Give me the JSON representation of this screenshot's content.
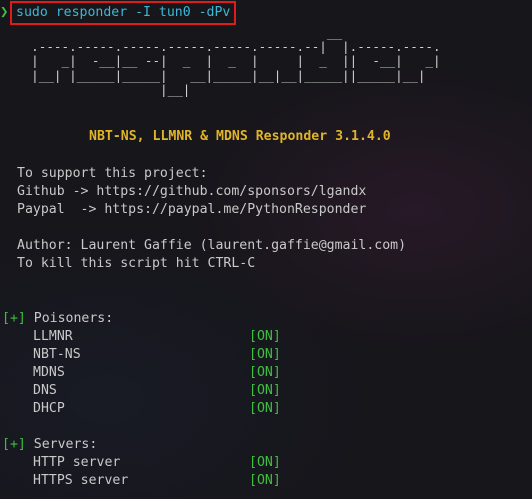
{
  "prompt": {
    "arrow": "❯",
    "command": "sudo responder -I tun0 -dPv"
  },
  "banner": {
    "ascii_art": "                                         __\n  .----.-----.-----.-----.-----.-----.--|  |.-----.----.\n  |   _|  -__|__ --|  _  |  _  |     |  _  ||  -__|   _|\n  |__| |_____|_____|   __|_____|__|__|_____||_____|__|\n                   |__|",
    "title": "NBT-NS, LLMNR & MDNS Responder 3.1.4.0"
  },
  "support": {
    "intro": "To support this project:",
    "github": "Github -> https://github.com/sponsors/lgandx",
    "paypal": "Paypal  -> https://paypal.me/PythonResponder"
  },
  "author": {
    "line": "Author: Laurent Gaffie (laurent.gaffie@gmail.com)",
    "kill": "To kill this script hit CTRL-C"
  },
  "poisoners": {
    "marker": "[+]",
    "heading": " Poisoners:",
    "items": [
      {
        "name": "LLMNR",
        "status": "[ON]"
      },
      {
        "name": "NBT-NS",
        "status": "[ON]"
      },
      {
        "name": "MDNS",
        "status": "[ON]"
      },
      {
        "name": "DNS",
        "status": "[ON]"
      },
      {
        "name": "DHCP",
        "status": "[ON]"
      }
    ]
  },
  "servers": {
    "marker": "[+]",
    "heading": " Servers:",
    "items": [
      {
        "name": "HTTP server",
        "status": "[ON]"
      },
      {
        "name": "HTTPS server",
        "status": "[ON]"
      }
    ]
  },
  "colors": {
    "background": "#17161b",
    "prompt_arrow": "#3fbf3f",
    "command_text": "#3ab8d8",
    "highlight_box": "#e01b1b",
    "title": "#e0b42a",
    "status_on": "#3fbf3f",
    "default_text": "#c9c9c9"
  }
}
